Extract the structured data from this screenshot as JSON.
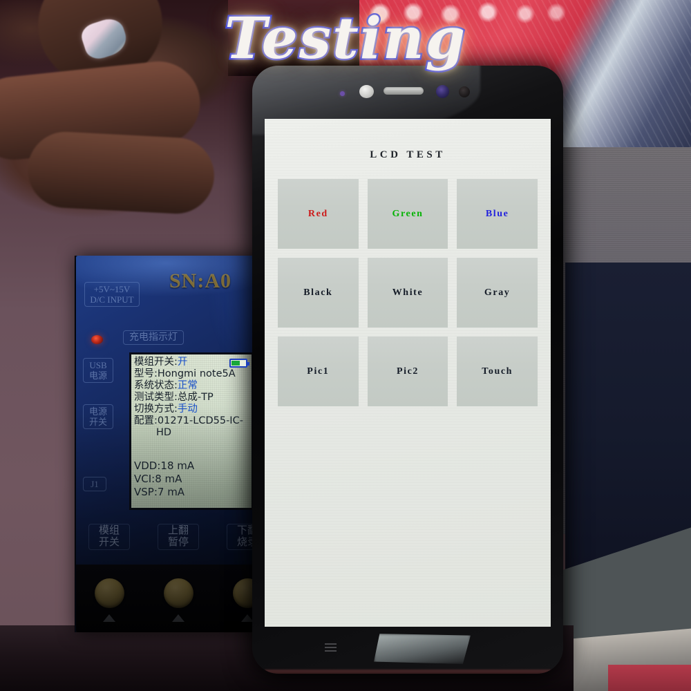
{
  "overlay": {
    "watermark_text": "Testing",
    "watermark_color": "#1b29e8"
  },
  "phone": {
    "bezel": {
      "notification_led": "notification-led",
      "proximity_sensor": "proximity-sensor",
      "earpiece": "earpiece-speaker",
      "front_camera": "front-camera",
      "aux_sensor": "ambient-light-sensor",
      "menu_key": "menu-key"
    },
    "screen": {
      "title": "LCD TEST",
      "tiles": [
        {
          "label": "Red",
          "color": "#cc1a1a",
          "class": "c-red"
        },
        {
          "label": "Green",
          "color": "#06b306",
          "class": "c-green"
        },
        {
          "label": "Blue",
          "color": "#2222dd",
          "class": "c-blue"
        },
        {
          "label": "Black",
          "color": "#141b27",
          "class": "c-dark"
        },
        {
          "label": "White",
          "color": "#141b27",
          "class": "c-dark"
        },
        {
          "label": "Gray",
          "color": "#141b27",
          "class": "c-dark"
        },
        {
          "label": "Pic1",
          "color": "#141b27",
          "class": "c-dark"
        },
        {
          "label": "Pic2",
          "color": "#141b27",
          "class": "c-dark"
        },
        {
          "label": "Touch",
          "color": "#141b27",
          "class": "c-dark"
        }
      ],
      "tile_color": "#c7cdc8",
      "background_color": "#e8eae6"
    }
  },
  "tester": {
    "serial_label": "SN:A0",
    "power_input_label": "+5V~15V\nD/C INPUT",
    "charge_indicator_label": "充电指示灯",
    "usb_power_label": "USB\n电源",
    "power_switch_label": "电源\n开关",
    "j1_label": "J1",
    "buttons": [
      {
        "label": "模组\n开关"
      },
      {
        "label": "上翻\n暂停"
      },
      {
        "label": "下翻\n烧录"
      }
    ],
    "display": {
      "rows": [
        {
          "key": "模组开关:",
          "value": "开",
          "value_color": "blue"
        },
        {
          "key": "型号:",
          "value": "Hongmi note5A",
          "value_color": "dark"
        },
        {
          "key": "系统状态:",
          "value": "正常",
          "value_color": "blue"
        },
        {
          "key": "测试类型:",
          "value": "总成-TP",
          "value_color": "dark"
        },
        {
          "key": "切换方式:",
          "value": "手动",
          "value_color": "blue"
        },
        {
          "key": "配置:",
          "value": "01271-LCD55-IC-",
          "value_color": "dark"
        }
      ],
      "config_wrap": "HD",
      "currents": [
        "VDD:18 mA",
        "VCI:8 mA",
        "VSP:7 mA"
      ],
      "battery_icon": "battery-icon"
    }
  }
}
